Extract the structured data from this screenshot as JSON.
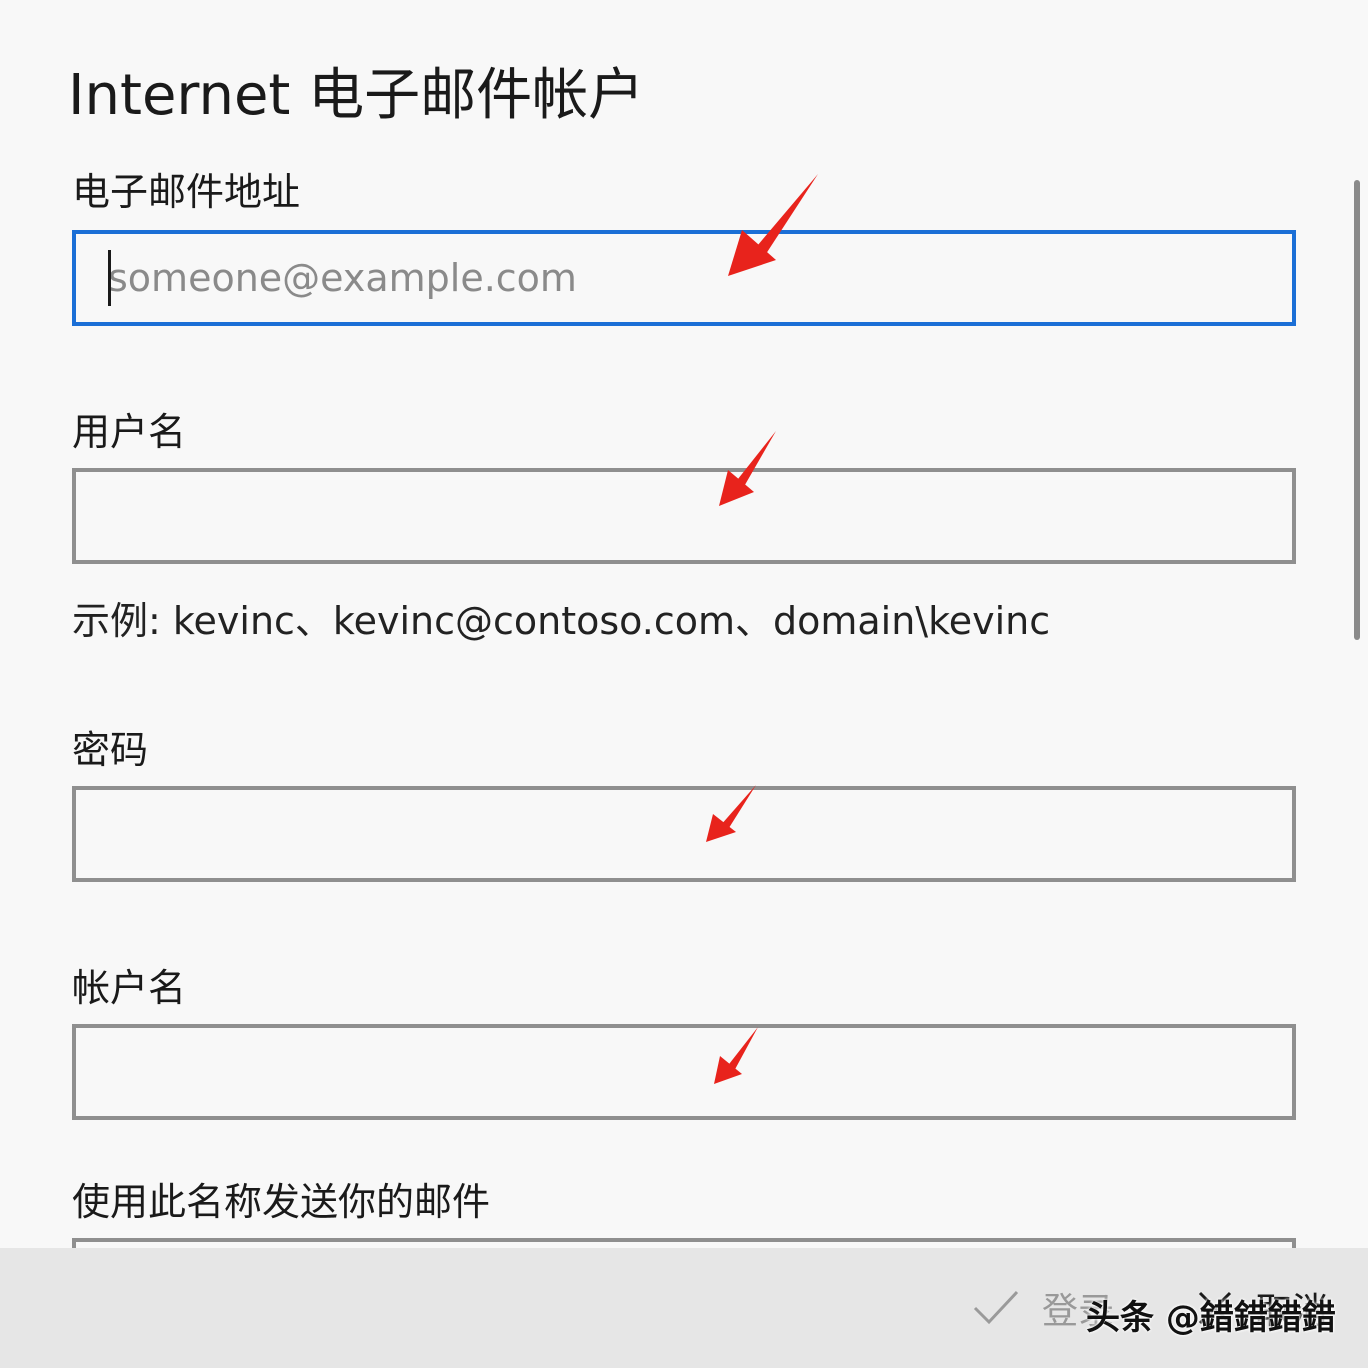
{
  "dialog": {
    "title": "Internet 电子邮件帐户"
  },
  "fields": {
    "email": {
      "label": "电子邮件地址",
      "placeholder": "someone@example.com",
      "value": ""
    },
    "username": {
      "label": "用户名",
      "value": ""
    },
    "username_hint": "示例: kevinc、kevinc@contoso.com、domain\\kevinc",
    "password": {
      "label": "密码",
      "value": ""
    },
    "account_name": {
      "label": "帐户名",
      "value": ""
    },
    "send_name": {
      "label": "使用此名称发送你的邮件",
      "value": ""
    }
  },
  "footer": {
    "login_label": "登录",
    "cancel_label": "取消"
  },
  "watermark": "头条 @錯錯錯錯",
  "colors": {
    "focus_border": "#1b6fd6",
    "field_border": "#8f8f8f",
    "annotation_arrow": "#e8231c"
  },
  "icons": {
    "login": "checkmark-icon",
    "cancel": "close-icon"
  }
}
